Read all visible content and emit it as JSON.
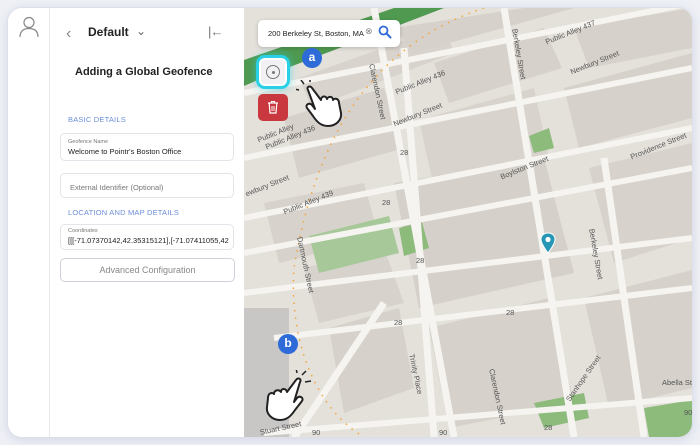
{
  "sidebar_panel": {
    "workspace_name": "Default",
    "title": "Adding a Global Geofence",
    "basic_details_header": "BASIC DETAILS",
    "geofence_name_label": "Geofence Name",
    "geofence_name_value": "Welcome to Pointr's Boston Office",
    "external_identifier_placeholder": "External Identifier (Optional)",
    "location_header": "LOCATION AND MAP DETAILS",
    "coordinates_label": "Coordinates",
    "coordinates_value": "[[[-71.07370142,42.35315121],[-71.07411055,42",
    "advanced_button": "Advanced Configuration"
  },
  "map": {
    "search_value": "200 Berkeley St, Boston, MA",
    "callout_a": "a",
    "callout_b": "b",
    "accent_color": "#2f6ad9",
    "highlight_color": "#2ad1e6",
    "delete_color": "#c9383f",
    "street_labels": {
      "public_alley_437": "Public Alley 437",
      "newbury_street_top": "Newbury Street",
      "public_alley_436": "Public Alley 436",
      "public_alley_436b": "Public Alley 436",
      "newbury_street": "Newbury Street",
      "clarendon_street": "Clarendon Street",
      "berkeley_street": "Berkeley Street",
      "berkeley_street_2": "Berkeley Street",
      "boylston_street": "Boylston Street",
      "providence_street": "Providence Street",
      "public_alley_439": "Public Alley 439",
      "dartmouth_street": "Dartmouth Street",
      "trinity_place": "Trinity Place",
      "clarendon_street_2": "Clarendon Street",
      "stanhope_street": "Stanhope Street",
      "stuart_street": "Stuart Street",
      "public_alley_truncated": "Public Alley",
      "ewbury_street": "ewbury Street",
      "abella_street": "Abella St",
      "road_28a": "28",
      "road_28b": "28",
      "road_28c": "28",
      "road_28d": "28",
      "road_28e": "28",
      "road_28f": "28",
      "road_90a": "90",
      "road_90b": "90",
      "road_90c": "90"
    }
  }
}
